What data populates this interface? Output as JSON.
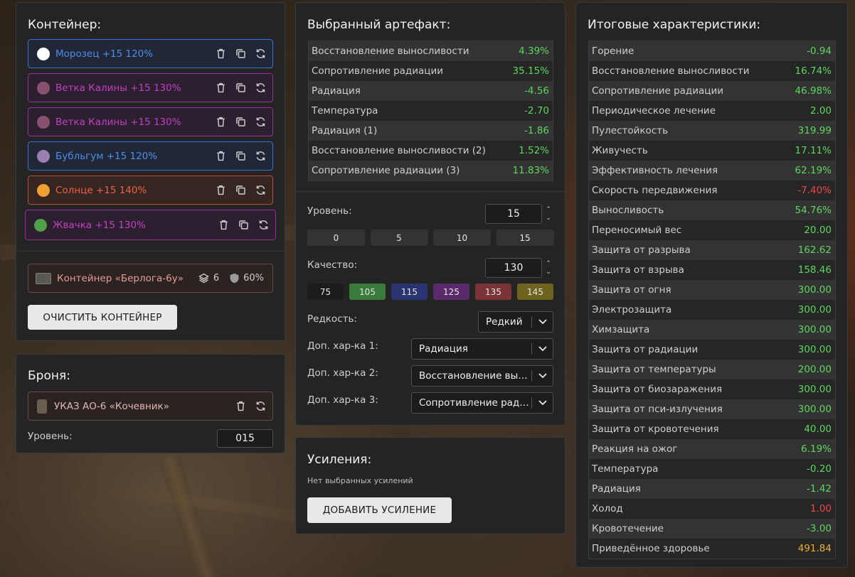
{
  "container": {
    "title": "Контейнер:",
    "artifacts": [
      {
        "name": "Морозец +15 120%",
        "color": "#4f8de8",
        "border": "#3a6fd8",
        "bg": "#202838",
        "icon_color": "#ffffff",
        "icon": "snowball-icon"
      },
      {
        "name": "Ветка Калины +15 130%",
        "color": "#c53ec5",
        "border": "#9a2e9a",
        "bg": "#2c2030",
        "icon_color": "#8a5070",
        "icon": "berry-branch-icon"
      },
      {
        "name": "Ветка Калины +15 130%",
        "color": "#c53ec5",
        "border": "#9a2e9a",
        "bg": "#2c2030",
        "icon_color": "#8a5070",
        "icon": "berry-branch-icon"
      },
      {
        "name": "Бубльгум +15 120%",
        "color": "#4f8de8",
        "border": "#3a6fd8",
        "bg": "#202838",
        "icon_color": "#9a80b0",
        "icon": "bubblegum-icon"
      },
      {
        "name": "Солнце +15 140%",
        "color": "#f06048",
        "border": "#c04838",
        "bg": "#352622",
        "icon_color": "#f0a030",
        "icon": "sun-icon"
      },
      {
        "name": "Жвачка +15 130%",
        "color": "#c53ec5",
        "border": "#9a2e9a",
        "bg": "#2c2030",
        "icon_color": "#50a048",
        "icon": "chewing-gum-icon"
      }
    ],
    "box": {
      "name": "Контейнер «Берлога-6у»",
      "slots": "6",
      "protection": "60%"
    },
    "clear_label": "ОЧИСТИТЬ КОНТЕЙНЕР"
  },
  "armor": {
    "title": "Броня:",
    "name": "УКАЗ АО-6 «Кочевник»",
    "level_label": "Уровень:",
    "level_value": "015"
  },
  "artifact": {
    "title": "Выбранный артефакт:",
    "stats": [
      {
        "label": "Восстановление выносливости",
        "value": "4.39%",
        "tone": "pos"
      },
      {
        "label": "Сопротивление радиации",
        "value": "35.15%",
        "tone": "pos"
      },
      {
        "label": "Радиация",
        "value": "-4.56",
        "tone": "pos"
      },
      {
        "label": "Температура",
        "value": "-2.70",
        "tone": "pos"
      },
      {
        "label": "Радиация (1)",
        "value": "-1.86",
        "tone": "pos"
      },
      {
        "label": "Восстановление выносливости (2)",
        "value": "1.52%",
        "tone": "pos"
      },
      {
        "label": "Сопротивление радиации (3)",
        "value": "11.83%",
        "tone": "pos"
      }
    ],
    "level_label": "Уровень:",
    "level_value": "15",
    "level_presets": [
      "0",
      "5",
      "10",
      "15"
    ],
    "quality_label": "Качество:",
    "quality_value": "130",
    "quality_presets": [
      {
        "label": "75",
        "color": "#1c1c1c"
      },
      {
        "label": "105",
        "color": "#3a7a3a"
      },
      {
        "label": "115",
        "color": "#2a3470"
      },
      {
        "label": "125",
        "color": "#5a2a6a"
      },
      {
        "label": "135",
        "color": "#7a3438"
      },
      {
        "label": "145",
        "color": "#6e6420"
      }
    ],
    "rarity_label": "Редкость:",
    "rarity_value": "Редкий",
    "extra1_label": "Доп. хар-ка 1:",
    "extra1_value": "Радиация",
    "extra2_label": "Доп. хар-ка 2:",
    "extra2_value": "Восстановление выносливости",
    "extra3_label": "Доп. хар-ка 3:",
    "extra3_value": "Сопротивление радиации"
  },
  "enhancements": {
    "title": "Усиления:",
    "empty_text": "Нет выбранных усилений",
    "add_label": "ДОБАВИТЬ УСИЛЕНИЕ"
  },
  "totals": {
    "title": "Итоговые характеристики:",
    "stats": [
      {
        "label": "Горение",
        "value": "-0.94",
        "tone": "pos"
      },
      {
        "label": "Восстановление выносливости",
        "value": "16.74%",
        "tone": "pos"
      },
      {
        "label": "Сопротивление радиации",
        "value": "46.98%",
        "tone": "pos"
      },
      {
        "label": "Периодическое лечение",
        "value": "2.00",
        "tone": "pos"
      },
      {
        "label": "Пулестойкость",
        "value": "319.99",
        "tone": "pos"
      },
      {
        "label": "Живучесть",
        "value": "17.11%",
        "tone": "pos"
      },
      {
        "label": "Эффективность лечения",
        "value": "62.19%",
        "tone": "pos"
      },
      {
        "label": "Скорость передвижения",
        "value": "-7.40%",
        "tone": "bad"
      },
      {
        "label": "Выносливость",
        "value": "54.76%",
        "tone": "pos"
      },
      {
        "label": "Переносимый вес",
        "value": "20.00",
        "tone": "pos"
      },
      {
        "label": "Защита от разрыва",
        "value": "162.62",
        "tone": "pos"
      },
      {
        "label": "Защита от взрыва",
        "value": "158.46",
        "tone": "pos"
      },
      {
        "label": "Защита от огня",
        "value": "300.00",
        "tone": "pos"
      },
      {
        "label": "Электрозащита",
        "value": "300.00",
        "tone": "pos"
      },
      {
        "label": "Химзащита",
        "value": "300.00",
        "tone": "pos"
      },
      {
        "label": "Защита от радиации",
        "value": "300.00",
        "tone": "pos"
      },
      {
        "label": "Защита от температуры",
        "value": "200.00",
        "tone": "pos"
      },
      {
        "label": "Защита от биозаражения",
        "value": "300.00",
        "tone": "pos"
      },
      {
        "label": "Защита от пси-излучения",
        "value": "300.00",
        "tone": "pos"
      },
      {
        "label": "Защита от кровотечения",
        "value": "40.00",
        "tone": "pos"
      },
      {
        "label": "Реакция на ожог",
        "value": "6.19%",
        "tone": "pos"
      },
      {
        "label": "Температура",
        "value": "-0.20",
        "tone": "pos"
      },
      {
        "label": "Радиация",
        "value": "-1.42",
        "tone": "pos"
      },
      {
        "label": "Холод",
        "value": "1.00",
        "tone": "bad"
      },
      {
        "label": "Кровотечение",
        "value": "-3.00",
        "tone": "pos"
      },
      {
        "label": "Приведённое здоровье",
        "value": "491.84",
        "tone": "gold"
      }
    ]
  }
}
